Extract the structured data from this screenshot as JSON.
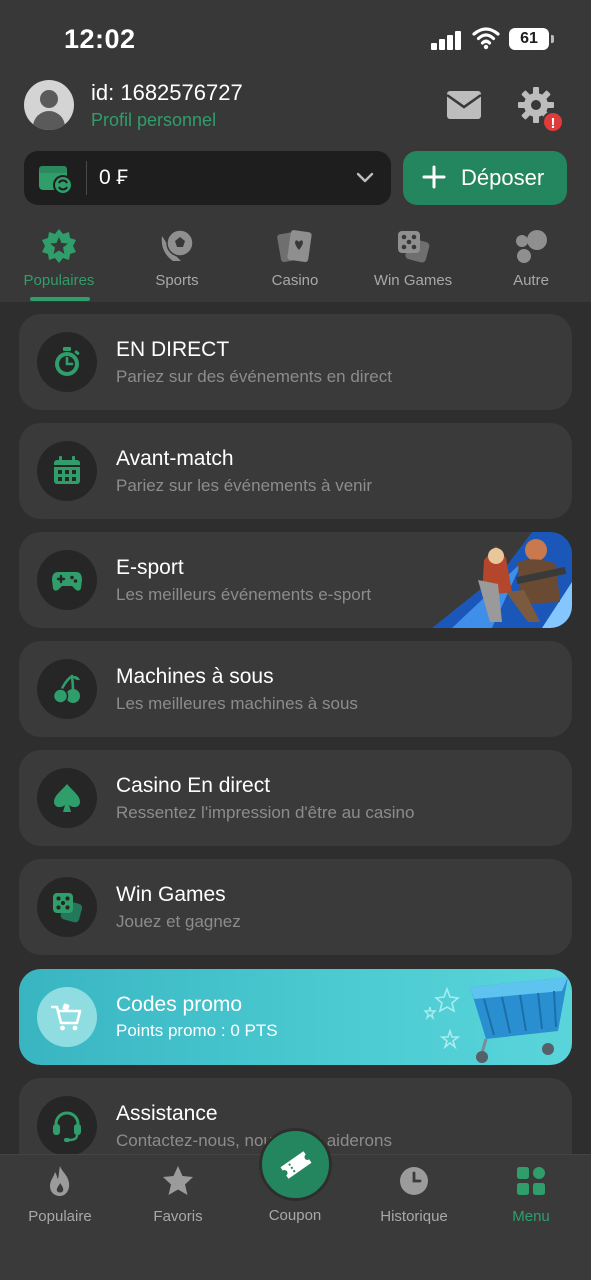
{
  "status_bar": {
    "time": "12:02",
    "battery": "61"
  },
  "profile": {
    "id_text": "id: 1682576727",
    "subtitle": "Profil personnel",
    "alert": "!"
  },
  "balance": {
    "amount": "0 ₣"
  },
  "deposit": {
    "label": "Déposer"
  },
  "categories": [
    {
      "label": "Populaires",
      "icon": "star-badge-icon",
      "active": true
    },
    {
      "label": "Sports",
      "icon": "soccer-ball-icon",
      "active": false
    },
    {
      "label": "Casino",
      "icon": "playing-cards-icon",
      "active": false
    },
    {
      "label": "Win Games",
      "icon": "dice-icon",
      "active": false
    },
    {
      "label": "Autre",
      "icon": "bubbles-icon",
      "active": false
    }
  ],
  "menu": [
    {
      "title": "EN DIRECT",
      "subtitle": "Pariez sur des événements en direct",
      "icon": "stopwatch-icon"
    },
    {
      "title": "Avant-match",
      "subtitle": "Pariez sur les événements à venir",
      "icon": "calendar-icon"
    },
    {
      "title": "E-sport",
      "subtitle": "Les meilleurs événements e-sport",
      "icon": "gamepad-icon"
    },
    {
      "title": "Machines à sous",
      "subtitle": "Les meilleures machines à sous",
      "icon": "cherries-icon"
    },
    {
      "title": "Casino En direct",
      "subtitle": "Ressentez l'impression d'être au casino",
      "icon": "spade-icon"
    },
    {
      "title": "Win Games",
      "subtitle": "Jouez et gagnez",
      "icon": "dice-icon"
    },
    {
      "title": "Assistance",
      "subtitle": "Contactez-nous, nous vous aiderons",
      "icon": "headset-icon"
    }
  ],
  "promo": {
    "title": "Codes promo",
    "subtitle": "Points promo : 0 PTS",
    "icon": "cart-icon"
  },
  "bottom_nav": [
    {
      "label": "Populaire",
      "icon": "flame-icon",
      "active": false
    },
    {
      "label": "Favoris",
      "icon": "star-icon",
      "active": false
    },
    {
      "label": "Coupon",
      "icon": "ticket-icon",
      "active": false
    },
    {
      "label": "Historique",
      "icon": "clock-icon",
      "active": false
    },
    {
      "label": "Menu",
      "icon": "grid-icon",
      "active": true
    }
  ],
  "colors": {
    "accent": "#24865e",
    "accent_text": "#2f9e6b",
    "card": "#3a3a3a",
    "promo": "#4ccbd2",
    "alert": "#e03b3b"
  }
}
